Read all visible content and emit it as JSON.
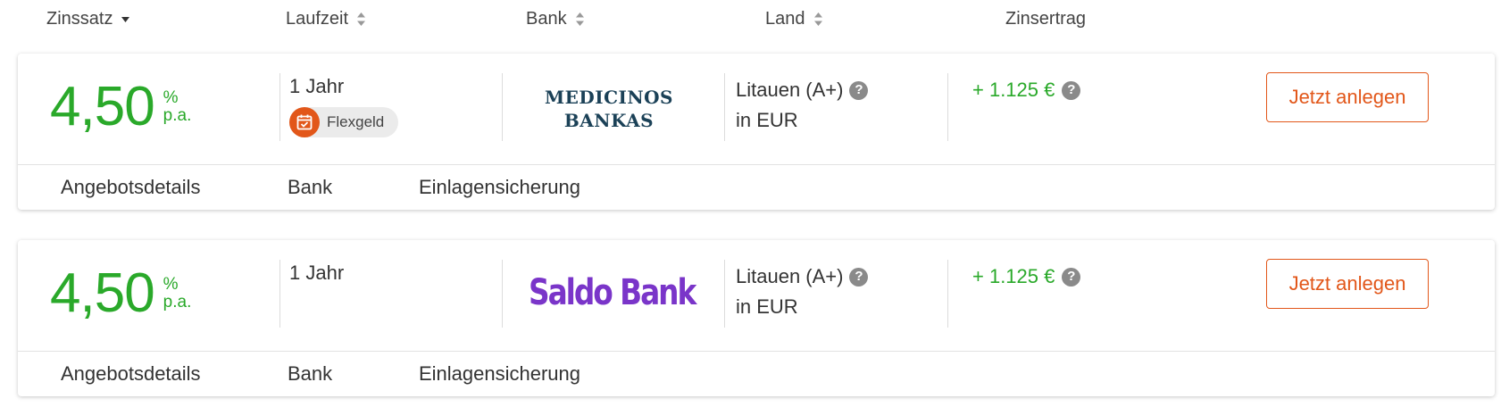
{
  "header": {
    "columns": [
      {
        "label": "Zinssatz",
        "sort": "sort-desc-icon"
      },
      {
        "label": "Laufzeit",
        "sort": "sort-both-icon"
      },
      {
        "label": "Bank",
        "sort": "sort-both-icon"
      },
      {
        "label": "Land",
        "sort": "sort-both-icon"
      },
      {
        "label": "Zinsertrag",
        "sort": ""
      }
    ]
  },
  "offers": [
    {
      "rate": "4,50",
      "rate_unit_top": "%",
      "rate_unit_bottom": "p.a.",
      "term": "1 Jahr",
      "badge": "Flexgeld",
      "bank_logo_lines": [
        "MEDICINOS",
        "BANKAS"
      ],
      "country": "Litauen (A+)",
      "currency": "in EUR",
      "yield": "+ 1.125 €",
      "cta": "Jetzt anlegen",
      "tabs": [
        "Angebotsdetails",
        "Bank",
        "Einlagensicherung"
      ]
    },
    {
      "rate": "4,50",
      "rate_unit_top": "%",
      "rate_unit_bottom": "p.a.",
      "term": "1 Jahr",
      "bank_logo": "Saldo Bank",
      "country": "Litauen (A+)",
      "currency": "in EUR",
      "yield": "+ 1.125 €",
      "cta": "Jetzt anlegen",
      "tabs": [
        "Angebotsdetails",
        "Bank",
        "Einlagensicherung"
      ]
    }
  ],
  "colors": {
    "rate_green": "#2aa92a",
    "cta_orange": "#e2571a",
    "medicinos_navy": "#1b4157",
    "saldo_purple": "#7a35c9"
  }
}
